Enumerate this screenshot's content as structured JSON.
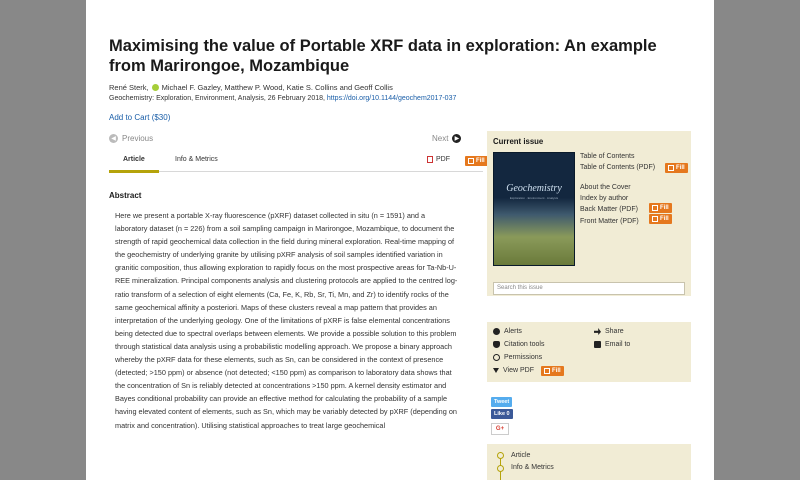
{
  "article": {
    "title": "Maximising the value of Portable XRF data in exploration: An example from Marirongoe, Mozambique",
    "author_first": "René Sterk,",
    "authors_rest": "Michael F. Gazley, Matthew P. Wood, Katie S. Collins and Geoff Collis",
    "journal_citation": "Geochemistry: Exploration, Environment, Analysis, 26 February 2018,",
    "doi": "https://doi.org/10.1144/geochem2017-037",
    "add_to_cart": "Add to Cart ($30)"
  },
  "pager": {
    "previous": "Previous",
    "next": "Next"
  },
  "tabs": {
    "article": "Article",
    "info": "Info & Metrics",
    "pdf": "PDF"
  },
  "fill_label": "Fill",
  "abstract": {
    "heading": "Abstract",
    "text": "Here we present a portable X-ray fluorescence (pXRF) dataset collected in situ (n = 1591) and a laboratory dataset (n = 226) from a soil sampling campaign in Marirongoe, Mozambique, to document the strength of rapid geochemical data collection in the field during mineral exploration. Real-time mapping of the geochemistry of underlying granite by utilising pXRF analysis of soil samples identified variation in granitic composition, thus allowing exploration to rapidly focus on the most prospective areas for Ta-Nb-U-REE mineralization. Principal components analysis and clustering protocols are applied to the centred log-ratio transform of a selection of eight elements (Ca, Fe, K, Rb, Sr, Ti, Mn, and Zr) to identify rocks of the same geochemical affinity a posteriori. Maps of these clusters reveal a map pattern that provides an interpretation of the underlying geology. One of the limitations of pXRF is false elemental concentrations being detected due to spectral overlaps between elements. We provide a possible solution to this problem through statistical data analysis using a probabilistic modelling approach. We propose a binary approach whereby the pXRF data for these elements, such as Sn, can be considered in the context of presence (detected; >150 ppm) or absence (not detected; <150 ppm) as comparison to laboratory data shows that the concentration of Sn is reliably detected at concentrations >150 ppm. A kernel density estimator and Bayes conditional probability can provide an effective method for calculating the probability of a sample having elevated content of elements, such as Sn, which may be variably detected by pXRF (depending on matrix and concentration). Utilising statistical approaches to treat large geochemical"
  },
  "sidebar": {
    "title": "Current issue",
    "cover_title": "Geochemistry",
    "cover_subtitle": "Exploration · Environment · Analysis",
    "links": {
      "toc": "Table of Contents",
      "toc_pdf": "Table of Contents (PDF)",
      "about_cover": "About the Cover",
      "index_author": "Index by author",
      "back_matter": "Back Matter (PDF)",
      "front_matter": "Front Matter (PDF)"
    },
    "search_placeholder": "Search this issue"
  },
  "tools": {
    "alerts": "Alerts",
    "share": "Share",
    "citation": "Citation tools",
    "email": "Email to",
    "permissions": "Permissions",
    "view_pdf": "View PDF"
  },
  "social": {
    "tweet": "Tweet",
    "like": "Like 0",
    "gplus": "G+"
  },
  "section_nav": {
    "article": "Article",
    "info": "Info & Metrics"
  }
}
